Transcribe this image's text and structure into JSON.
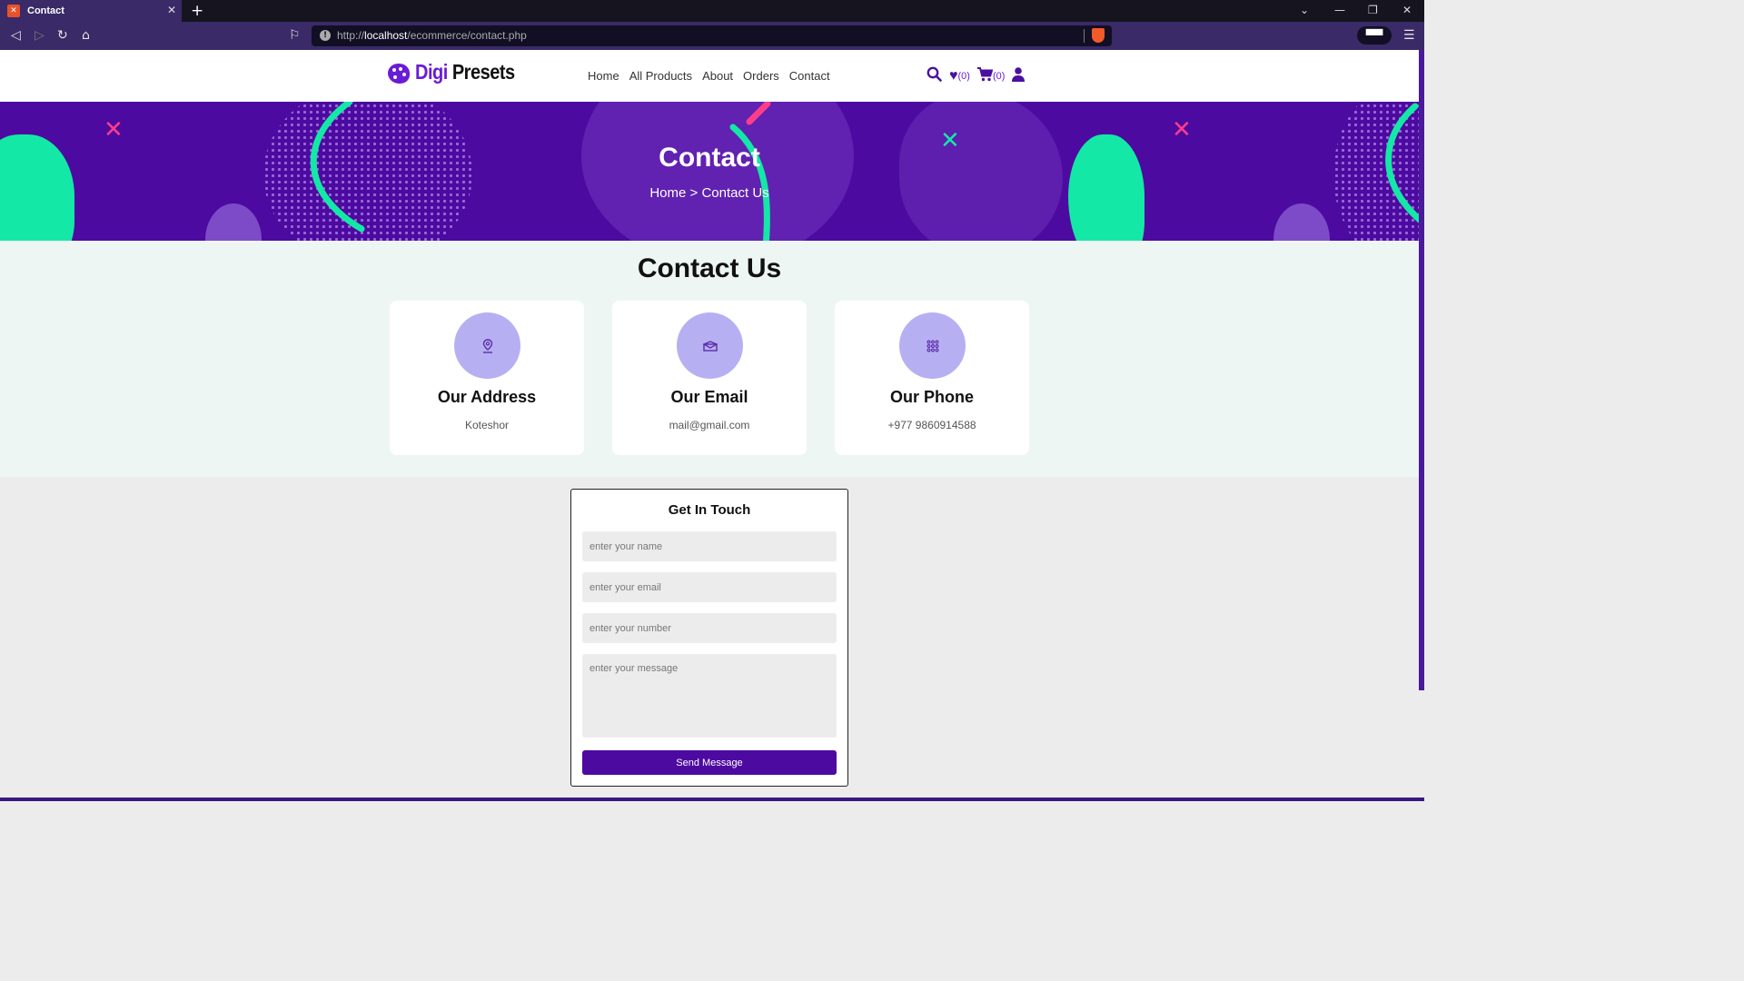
{
  "browser": {
    "tab_title": "Contact",
    "tab_favicon": "xampp-icon",
    "url_scheme": "http://",
    "url_host": "localhost",
    "url_path": "/ecommerce/contact.php"
  },
  "header": {
    "logo_word1": "Digi",
    "logo_word2": "Presets",
    "nav": [
      "Home",
      "All Products",
      "About",
      "Orders",
      "Contact"
    ],
    "wishlist_count": "(0)",
    "cart_count": "(0)"
  },
  "hero": {
    "title": "Contact",
    "breadcrumb": "Home > Contact Us",
    "colors": {
      "background": "#4d0aa0",
      "green": "#14e8a6",
      "pink": "#ff3d8b"
    }
  },
  "contact": {
    "heading": "Contact Us",
    "cards": [
      {
        "icon": "map-pin-icon",
        "title": "Our Address",
        "value": "Koteshor"
      },
      {
        "icon": "envelope-icon",
        "title": "Our Email",
        "value": "mail@gmail.com"
      },
      {
        "icon": "keypad-icon",
        "title": "Our Phone",
        "value": "+977 9860914588"
      }
    ]
  },
  "form": {
    "title": "Get In Touch",
    "name_placeholder": "enter your name",
    "email_placeholder": "enter your email",
    "number_placeholder": "enter your number",
    "message_placeholder": "enter your message",
    "submit_label": "Send Message"
  },
  "accent_color": "#4d0aa0"
}
